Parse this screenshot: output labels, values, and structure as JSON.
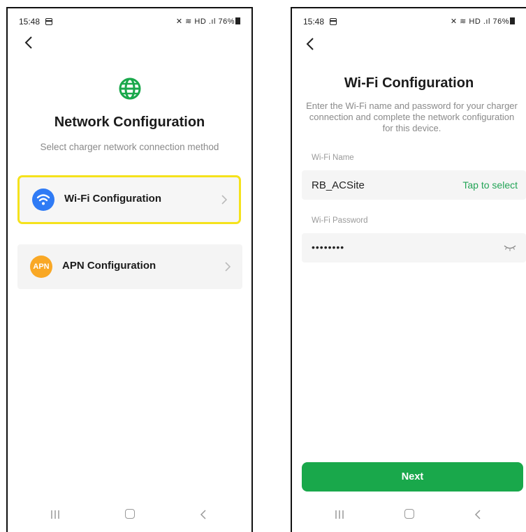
{
  "status_bar": {
    "time": "15:48",
    "battery": "76%",
    "signal_text": "HD .ıl"
  },
  "screen1": {
    "title": "Network Configuration",
    "subtitle": "Select charger network connection method",
    "options": [
      {
        "label": "Wi-Fi Configuration",
        "icon": "wifi-icon",
        "highlighted": true
      },
      {
        "label": "APN Configuration",
        "icon": "apn-icon",
        "badge": "APN",
        "highlighted": false
      }
    ]
  },
  "screen2": {
    "title": "Wi-Fi Configuration",
    "description": "Enter the Wi-Fi name and password for your charger connection and complete the network configuration for this device.",
    "wifi_name_label": "Wi-Fi Name",
    "wifi_name_value": "RB_ACSite",
    "wifi_name_action": "Tap to select",
    "wifi_password_label": "Wi-Fi Password",
    "wifi_password_value": "••••••••",
    "next_label": "Next"
  },
  "colors": {
    "accent_green": "#19a84b",
    "wifi_blue": "#2f7bf5",
    "apn_orange": "#f9a825",
    "highlight_yellow": "#f5e21c"
  }
}
